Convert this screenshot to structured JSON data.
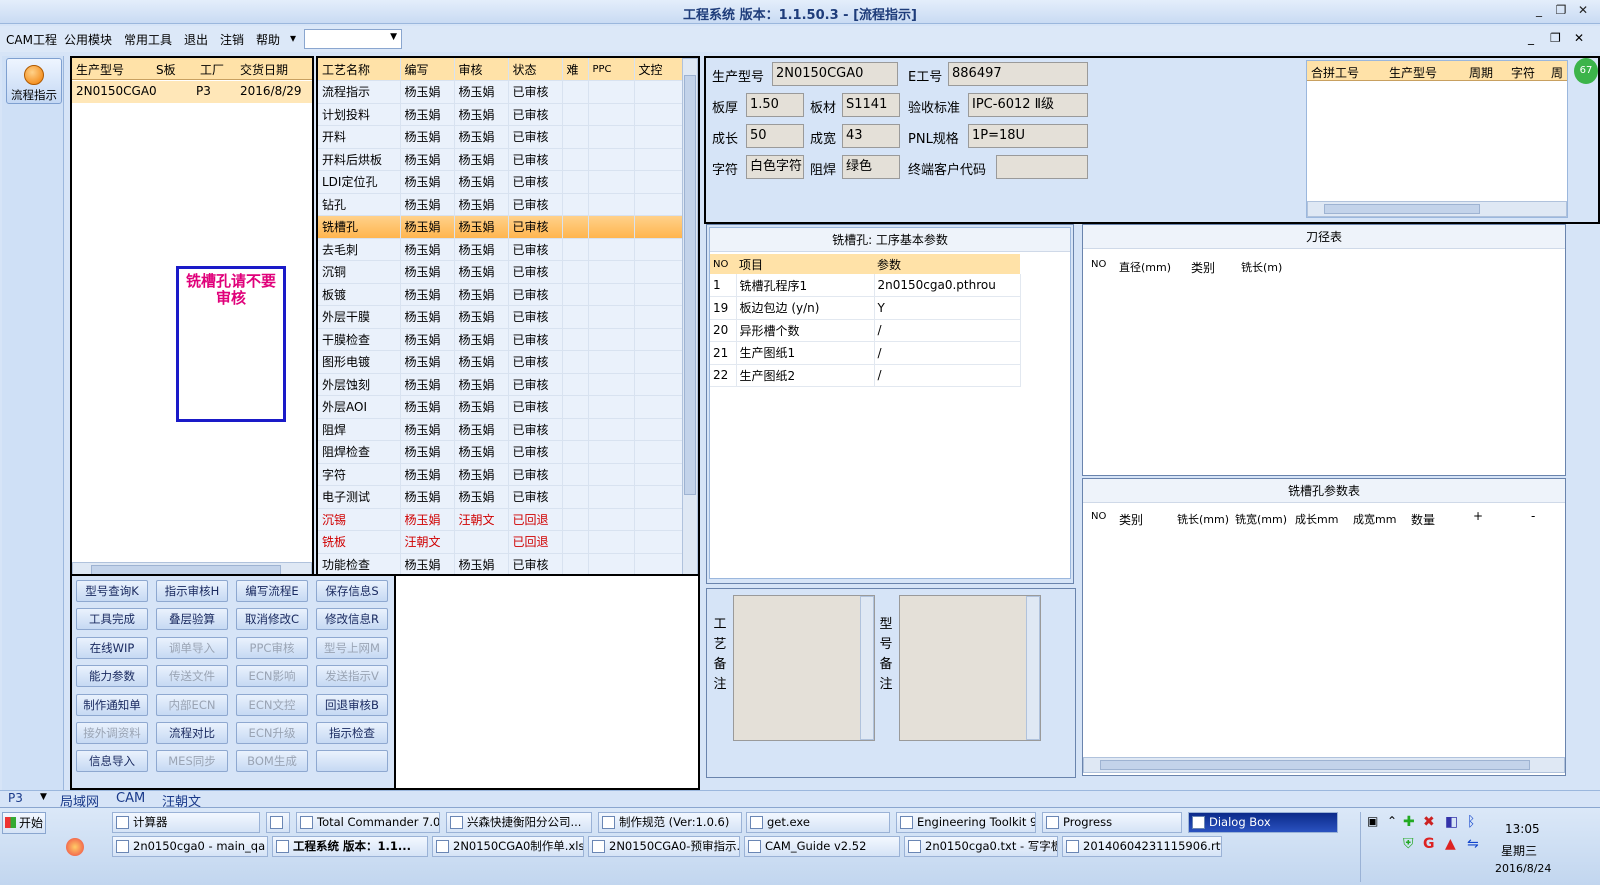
{
  "window": {
    "title": "工程系统  版本：1.1.50.3 - [流程指示]",
    "min": "_",
    "restore": "❐",
    "close": "✕"
  },
  "menu": {
    "items": [
      "CAM工程",
      "公用模块",
      "常用工具",
      "退出",
      "注销",
      "帮助"
    ],
    "help_arrow": "▾",
    "combo_value": ""
  },
  "left": {
    "flow_button": "流程指示"
  },
  "orders": {
    "headers": [
      "生产型号",
      "S板",
      "工厂",
      "交货日期"
    ],
    "rows": [
      [
        "2N0150CGA0",
        "",
        "P3",
        "2016/8/29"
      ]
    ],
    "note": "铣槽孔请不要审核"
  },
  "process": {
    "headers": [
      "工艺名称",
      "编写",
      "审核",
      "状态",
      "难",
      "PPC",
      "文控"
    ],
    "rows": [
      [
        "流程指示",
        "杨玉娟",
        "杨玉娟",
        "已审核"
      ],
      [
        "计划投料",
        "杨玉娟",
        "杨玉娟",
        "已审核"
      ],
      [
        "开料",
        "杨玉娟",
        "杨玉娟",
        "已审核"
      ],
      [
        "开料后烘板",
        "杨玉娟",
        "杨玉娟",
        "已审核"
      ],
      [
        "LDI定位孔",
        "杨玉娟",
        "杨玉娟",
        "已审核"
      ],
      [
        "钻孔",
        "杨玉娟",
        "杨玉娟",
        "已审核"
      ],
      [
        "铣槽孔",
        "杨玉娟",
        "杨玉娟",
        "已审核"
      ],
      [
        "去毛刺",
        "杨玉娟",
        "杨玉娟",
        "已审核"
      ],
      [
        "沉铜",
        "杨玉娟",
        "杨玉娟",
        "已审核"
      ],
      [
        "板镀",
        "杨玉娟",
        "杨玉娟",
        "已审核"
      ],
      [
        "外层干膜",
        "杨玉娟",
        "杨玉娟",
        "已审核"
      ],
      [
        "干膜检查",
        "杨玉娟",
        "杨玉娟",
        "已审核"
      ],
      [
        "图形电镀",
        "杨玉娟",
        "杨玉娟",
        "已审核"
      ],
      [
        "外层蚀刻",
        "杨玉娟",
        "杨玉娟",
        "已审核"
      ],
      [
        "外层AOI",
        "杨玉娟",
        "杨玉娟",
        "已审核"
      ],
      [
        "阻焊",
        "杨玉娟",
        "杨玉娟",
        "已审核"
      ],
      [
        "阻焊检查",
        "杨玉娟",
        "杨玉娟",
        "已审核"
      ],
      [
        "字符",
        "杨玉娟",
        "杨玉娟",
        "已审核"
      ],
      [
        "电子测试",
        "杨玉娟",
        "杨玉娟",
        "已审核"
      ],
      [
        "沉锡",
        "杨玉娟",
        "汪朝文",
        "已回退"
      ],
      [
        "铣板",
        "汪朝文",
        "",
        "已回退"
      ],
      [
        "功能检查",
        "杨玉娟",
        "杨玉娟",
        "已审核"
      ]
    ]
  },
  "buttons": [
    [
      "型号查询K",
      "指示审核H",
      "编写流程E",
      "保存信息S"
    ],
    [
      "工具完成",
      "叠层验算",
      "取消修改C",
      "修改信息R"
    ],
    [
      "在线WIP",
      "调单导入",
      "PPC审核",
      "型号上网M"
    ],
    [
      "能力参数",
      "传送文件",
      "ECN影响",
      "发送指示V"
    ],
    [
      "制作通知单",
      "内部ECN",
      "ECN文控",
      "回退审核B"
    ],
    [
      "接外调资料",
      "流程对比",
      "ECN升级",
      "指示检查"
    ],
    [
      "信息导入",
      "MES同步",
      "BOM生成",
      ""
    ]
  ],
  "disabled_buttons": [
    "调单导入",
    "PPC审核",
    "型号上网M",
    "传送文件",
    "ECN影响",
    "发送指示V",
    "内部ECN",
    "ECN文控",
    "接外调资料",
    "ECN升级",
    "MES同步",
    "BOM生成"
  ],
  "info": {
    "model_label": "生产型号",
    "model": "2N0150CGA0",
    "eno_label": "E工号",
    "eno": "886497",
    "thick_label": "板厚",
    "thick": "1.50",
    "mat_label": "板材",
    "mat": "S1141",
    "std_label": "验收标准",
    "std": "IPC-6012 Ⅱ级",
    "grow_label": "成长",
    "grow": "50",
    "width_label": "成宽",
    "width": "43",
    "pnl_label": "PNL规格",
    "pnl": "1P=18U",
    "char_label": "字符",
    "char": "白色字符",
    "mask_label": "阻焊",
    "mask": "绿色",
    "cust_label": "终端客户代码",
    "cust": ""
  },
  "merge_headers": [
    "合拼工号",
    "生产型号",
    "周期",
    "字符",
    "周"
  ],
  "badge": "67",
  "params": {
    "title": "铣槽孔: 工序基本参数",
    "headers": [
      "NO",
      "项目",
      "参数"
    ],
    "rows": [
      [
        "1",
        "铣槽孔程序1",
        "2n0150cga0.pthrou"
      ],
      [
        "19",
        "板边包边 (y/n)",
        "Y"
      ],
      [
        "20",
        "异形槽个数",
        "/"
      ],
      [
        "21",
        "生产图纸1",
        "/"
      ],
      [
        "22",
        "生产图纸2",
        "/"
      ]
    ]
  },
  "tool_table": {
    "title": "刀径表",
    "headers": [
      "NO",
      "直径(mm)",
      "类别",
      "铣长(m)"
    ]
  },
  "slot_table": {
    "title": "铣槽孔参数表",
    "headers": [
      "NO",
      "类别",
      "铣长(mm)",
      "铣宽(mm)",
      "成长mm",
      "成宽mm",
      "数量",
      "+",
      "-"
    ]
  },
  "remarks": {
    "process_label": "工艺备注",
    "model_label": "型号备注"
  },
  "status": {
    "factory": "P3",
    "items": [
      "局域网",
      "CAM",
      "汪朝文"
    ]
  },
  "taskbar": {
    "start": "开始",
    "row1": [
      "计算器",
      "",
      "Total Commander 7.0 ...",
      "兴森快捷衡阳分公司...",
      "制作规范 (Ver:1.0.6)",
      "get.exe",
      "Engineering Toolkit 9.0...",
      "Progress",
      "Dialog Box"
    ],
    "row2": [
      "2n0150cga0 - main_qa",
      "工程系统  版本：1.1...",
      "2N0150CGA0制作单.xls ...",
      "2N0150CGA0-预审指示...",
      "CAM_Guide v2.52",
      "2n0150cga0.txt - 写字板",
      "20140604231115906.rtf..."
    ],
    "time": "13:05",
    "weekday": "星期三",
    "date": "2016/8/24"
  }
}
